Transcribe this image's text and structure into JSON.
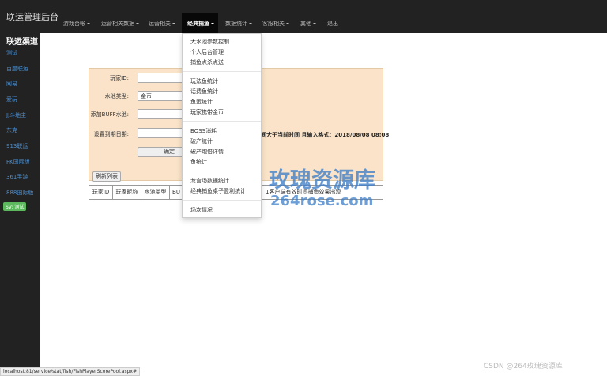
{
  "app": {
    "brand": "联运管理后台"
  },
  "nav": {
    "items": [
      "游戏台帐",
      "运营相关数据",
      "运营相关",
      "经典捕鱼",
      "数据统计",
      "客服相关",
      "其他",
      "退出"
    ]
  },
  "sidebar": {
    "title": "联运渠道",
    "items": [
      "测试",
      "百度联运",
      "网易",
      "爱玩",
      "JJ斗地主",
      "东克",
      "913联运",
      "FK国际版",
      "361手游",
      "888国际版"
    ],
    "badge": "SV: 测试"
  },
  "form": {
    "player_id_label": "玩家ID:",
    "pool_type_label": "水池类型:",
    "pool_type_value": "金币",
    "buff_label": "添加BUFF水池:",
    "expire_label": "设置到期日期:",
    "hint": "间大于当前时间 且输入格式：2018/08/08 08:08",
    "confirm_btn": "确定",
    "refresh_btn": "刷新列表"
  },
  "table": {
    "headers": [
      "玩家ID",
      "玩家昵称",
      "水池类型",
      "BU"
    ],
    "tail_text": "1客户端有效时间捕鱼效果出现"
  },
  "dropdown": {
    "items": [
      "大水池参数控制",
      "个人后台管理",
      "捕鱼点杀点送",
      "玩法鱼统计",
      "话费鱼统计",
      "鱼蛋统计",
      "玩家携带金币",
      "BOSS消耗",
      "破产统计",
      "破产炮倍详情",
      "鱼统计",
      "龙宫场数据统计",
      "经典捕鱼桌子盈利统计",
      "场次情况"
    ]
  },
  "watermark": {
    "title": "玫瑰资源库",
    "url": "264rose.com"
  },
  "statusbar": {
    "url": "localhost:81/service/stat/fish/FishPlayerScorePool.aspx#"
  },
  "credit": "CSDN @264玫瑰资源库"
}
